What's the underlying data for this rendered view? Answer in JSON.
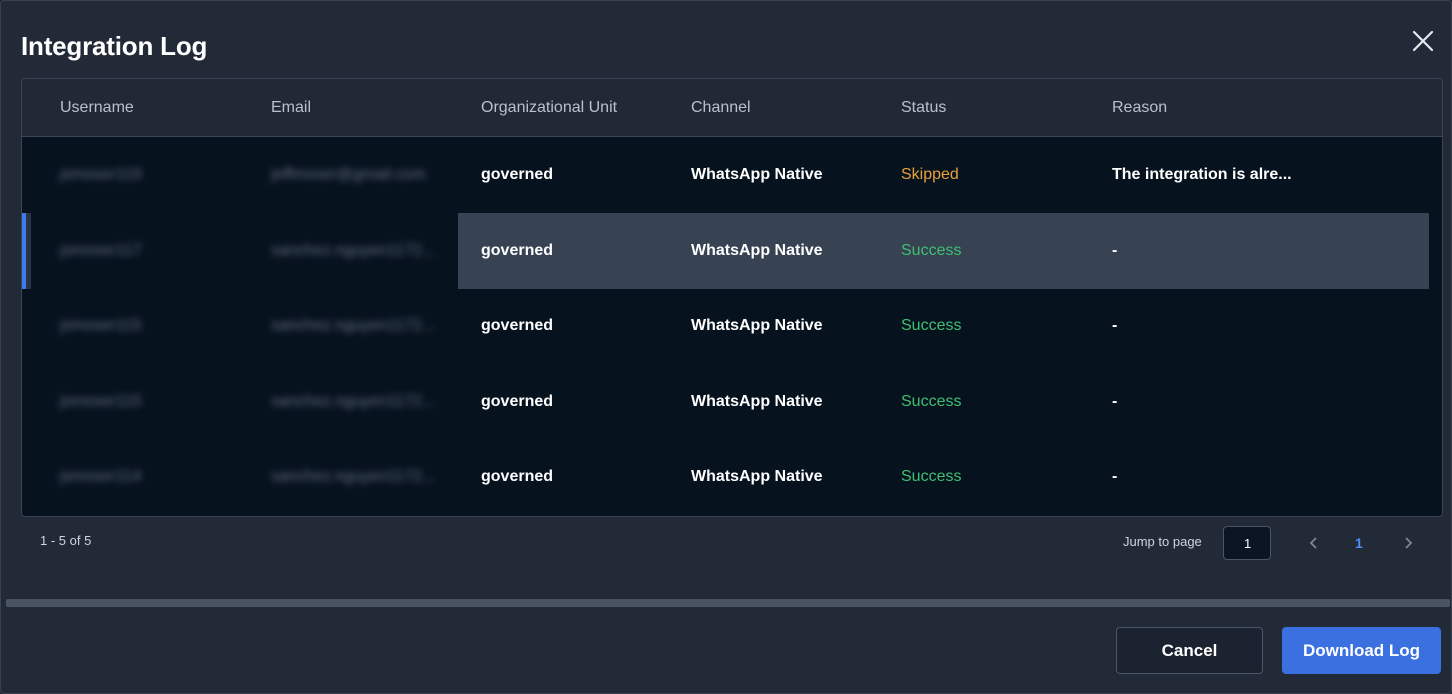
{
  "modal": {
    "title": "Integration Log",
    "close_icon": "close-icon"
  },
  "table": {
    "columns": [
      "Username",
      "Email",
      "Organizational Unit",
      "Channel",
      "Status",
      "Reason"
    ],
    "rows": [
      {
        "username": "jsmoser119",
        "email": "jeffmoser@gmail.com",
        "org_unit": "governed",
        "channel": "WhatsApp Native",
        "status": "Skipped",
        "reason": "The integration is alre..."
      },
      {
        "username": "jsmoser117",
        "email": "sanchez.nguyen1172...",
        "org_unit": "governed",
        "channel": "WhatsApp Native",
        "status": "Success",
        "reason": "-"
      },
      {
        "username": "jsmoser115",
        "email": "sanchez.nguyen1172...",
        "org_unit": "governed",
        "channel": "WhatsApp Native",
        "status": "Success",
        "reason": "-"
      },
      {
        "username": "jsmoser115",
        "email": "sanchez.nguyen1172...",
        "org_unit": "governed",
        "channel": "WhatsApp Native",
        "status": "Success",
        "reason": "-"
      },
      {
        "username": "jsmoser114",
        "email": "sanchez.nguyen1172...",
        "org_unit": "governed",
        "channel": "WhatsApp Native",
        "status": "Success",
        "reason": "-"
      }
    ],
    "selected_row": 1
  },
  "pagination": {
    "range": "1 - 5 of 5",
    "jump_label": "Jump to page",
    "jump_value": "1",
    "current_page": "1",
    "prev_icon": "chevron-left-icon",
    "next_icon": "chevron-right-icon"
  },
  "actions": {
    "cancel": "Cancel",
    "download": "Download Log"
  },
  "colors": {
    "skipped": "#e8a13a",
    "success": "#3fbf6f",
    "accent": "#3a70e0"
  }
}
